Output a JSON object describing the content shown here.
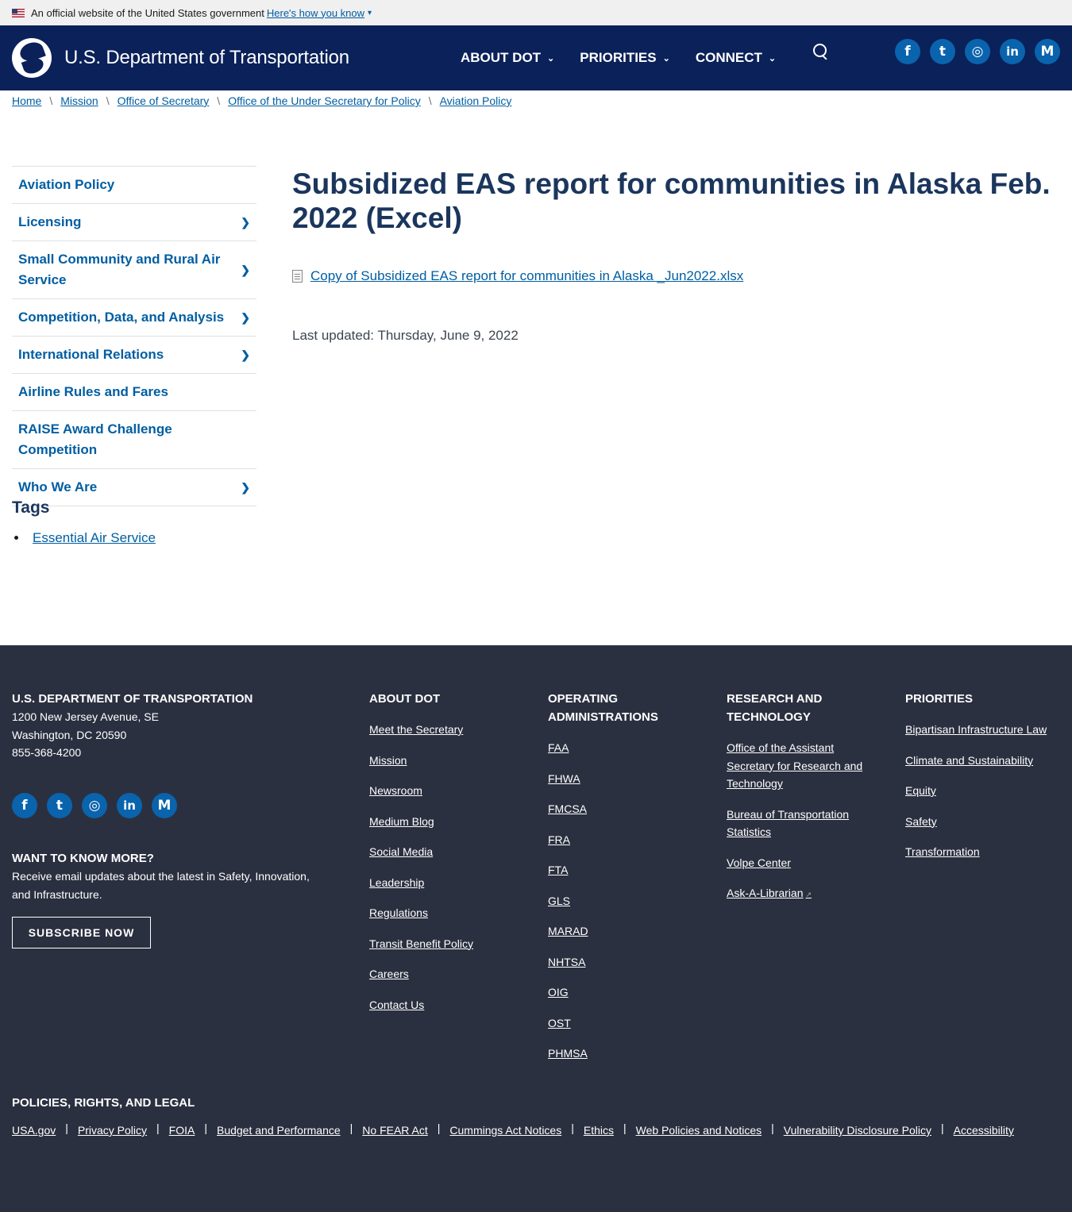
{
  "gov_banner": {
    "text": "An official website of the United States government",
    "link": "Here's how you know"
  },
  "header": {
    "logo_text": "U.S. Department of Transportation",
    "nav": [
      {
        "label": "ABOUT DOT"
      },
      {
        "label": "PRIORITIES"
      },
      {
        "label": "CONNECT"
      }
    ],
    "social": [
      "f",
      "t",
      "◎",
      "in",
      "M"
    ]
  },
  "breadcrumb": [
    "Home",
    "Mission",
    "Office of Secretary",
    "Office of the Under Secretary for Policy",
    "Aviation Policy"
  ],
  "sidenav": [
    {
      "label": "Aviation Policy",
      "has_children": false
    },
    {
      "label": "Licensing",
      "has_children": true
    },
    {
      "label": "Small Community and Rural Air Service",
      "has_children": true
    },
    {
      "label": "Competition, Data, and Analysis",
      "has_children": true
    },
    {
      "label": "International Relations",
      "has_children": true
    },
    {
      "label": "Airline Rules and Fares",
      "has_children": false
    },
    {
      "label": "RAISE Award Challenge Competition",
      "has_children": false
    },
    {
      "label": "Who We Are",
      "has_children": true
    }
  ],
  "tags": {
    "title": "Tags",
    "items": [
      "Essential Air Service"
    ]
  },
  "main": {
    "title": "Subsidized EAS report for communities in Alaska Feb. 2022 (Excel)",
    "file_link": "Copy of Subsidized EAS report for communities in Alaska _Jun2022.xlsx",
    "last_updated": "Last updated: Thursday, June 9, 2022"
  },
  "footer": {
    "org_title": "U.S. DEPARTMENT OF TRANSPORTATION",
    "address1": "1200 New Jersey Avenue, SE",
    "address2": "Washington, DC 20590",
    "phone": "855-368-4200",
    "want_title": "WANT TO KNOW MORE?",
    "want_text": "Receive email updates about the latest in Safety, Innovation, and Infrastructure.",
    "subscribe": "SUBSCRIBE NOW",
    "about": {
      "title": "ABOUT DOT",
      "links": [
        "Meet the Secretary",
        "Mission",
        "Newsroom",
        "Medium Blog",
        "Social Media",
        "Leadership",
        "Regulations",
        "Transit Benefit Policy",
        "Careers",
        "Contact Us"
      ]
    },
    "opadmin": {
      "title": "OPERATING ADMINISTRATIONS",
      "links": [
        "FAA",
        "FHWA",
        "FMCSA",
        "FRA",
        "FTA",
        "GLS",
        "MARAD",
        "NHTSA",
        "OIG",
        "OST",
        "PHMSA"
      ]
    },
    "research": {
      "title": "RESEARCH AND TECHNOLOGY",
      "links": [
        "Office of the Assistant Secretary for Research and Technology",
        "Bureau of Transportation Statistics",
        "Volpe Center",
        "Ask-A-Librarian"
      ]
    },
    "priorities": {
      "title": "PRIORITIES",
      "links": [
        "Bipartisan Infrastructure Law",
        "Climate and Sustainability",
        "Equity",
        "Safety",
        "Transformation"
      ]
    },
    "legal_title": "POLICIES, RIGHTS, AND LEGAL",
    "legal_links": [
      "USA.gov",
      "Privacy Policy",
      "FOIA",
      "Budget and Performance",
      "No FEAR Act",
      "Cummings Act Notices",
      "Ethics",
      "Web Policies and Notices",
      "Vulnerability Disclosure Policy",
      "Accessibility"
    ]
  }
}
